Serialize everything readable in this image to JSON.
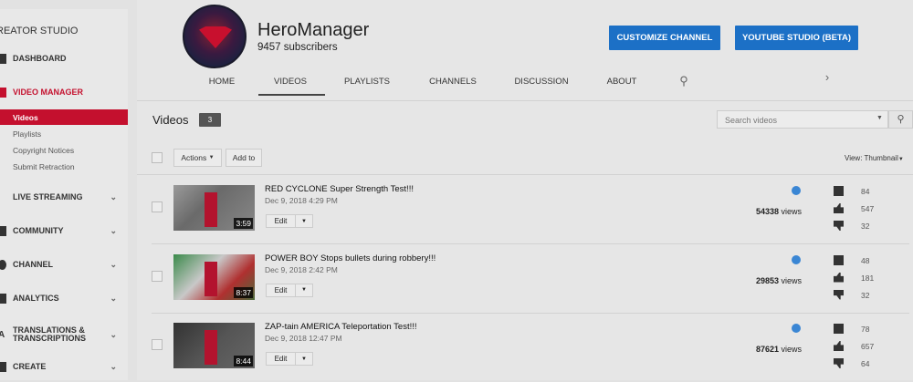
{
  "sidebar": {
    "title": "REATOR STUDIO",
    "items": [
      {
        "label": "DASHBOARD"
      },
      {
        "label": "VIDEO MANAGER"
      },
      {
        "label": "LIVE STREAMING"
      },
      {
        "label": "COMMUNITY"
      },
      {
        "label": "CHANNEL"
      },
      {
        "label": "ANALYTICS"
      },
      {
        "label": "TRANSLATIONS &\nTRANSCRIPTIONS"
      },
      {
        "label": "CREATE"
      }
    ],
    "sub_items": [
      {
        "label": "Videos"
      },
      {
        "label": "Playlists"
      },
      {
        "label": "Copyright Notices"
      },
      {
        "label": "Submit Retraction"
      }
    ]
  },
  "channel": {
    "name": "HeroManager",
    "subscribers": "9457 subscribers",
    "customize_label": "CUSTOMIZE CHANNEL",
    "studio_label": "YOUTUBE STUDIO (BETA)"
  },
  "tabs": [
    {
      "label": "HOME"
    },
    {
      "label": "VIDEOS"
    },
    {
      "label": "PLAYLISTS"
    },
    {
      "label": "CHANNELS"
    },
    {
      "label": "DISCUSSION"
    },
    {
      "label": "ABOUT"
    }
  ],
  "videos_section": {
    "title": "Videos",
    "count": "3",
    "search_placeholder": "Search videos",
    "actions_label": "Actions",
    "add_to_label": "Add to",
    "view_label": "View:",
    "view_value": "Thumbnail"
  },
  "videos": [
    {
      "title": "RED CYCLONE Super Strength Test!!!",
      "date": "Dec 9, 2018 4:29 PM",
      "duration": "3:59",
      "views": "54338",
      "views_suffix": "views",
      "comments": "84",
      "likes": "547",
      "dislikes": "32",
      "edit": "Edit"
    },
    {
      "title": "POWER BOY Stops bullets during robbery!!!",
      "date": "Dec 9, 2018 2:42 PM",
      "duration": "8:37",
      "views": "29853",
      "views_suffix": "views",
      "comments": "48",
      "likes": "181",
      "dislikes": "32",
      "edit": "Edit"
    },
    {
      "title": "ZAP-tain AMERICA Teleportation Test!!!",
      "date": "Dec 9, 2018 12:47 PM",
      "duration": "8:44",
      "views": "87621",
      "views_suffix": "views",
      "comments": "78",
      "likes": "657",
      "dislikes": "64",
      "edit": "Edit"
    }
  ],
  "colors": {
    "accent": "#c4102e",
    "button_blue": "#1c70c6"
  }
}
